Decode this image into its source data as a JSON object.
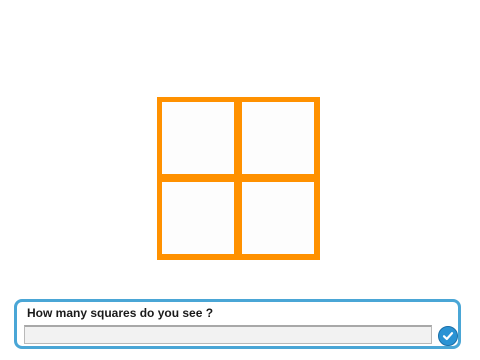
{
  "puzzle": {
    "stroke_color": "#ff9100",
    "fill_color": "#fdfdfd"
  },
  "ask": {
    "question": "How many squares do you see ?",
    "answer_value": "",
    "border_color": "#4aa6d6",
    "submit_icon": "checkmark-icon",
    "submit_color": "#2b93d4"
  }
}
